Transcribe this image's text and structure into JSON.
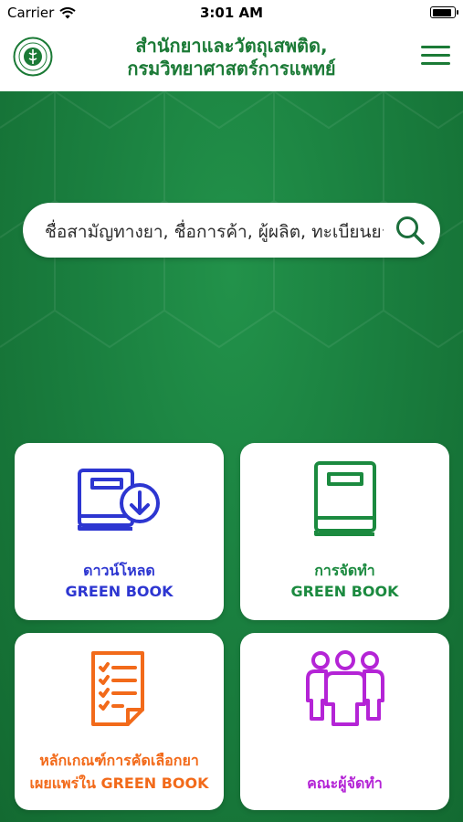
{
  "status_bar": {
    "carrier": "Carrier",
    "time": "3:01 AM",
    "battery_level": 0.9
  },
  "header": {
    "title_line1": "สำนักยาและวัตถุเสพติด,",
    "title_line2": "กรมวิทยาศาสตร์การแพทย์"
  },
  "search": {
    "placeholder": "ชื่อสามัญทางยา, ชื่อการค้า, ผู้ผลิต, ทะเบียนยา"
  },
  "tiles": [
    {
      "line1": "ดาวน์โหลด",
      "line2": "GREEN BOOK",
      "color": "#2d36d1",
      "icon": "download-book-icon"
    },
    {
      "line1": "การจัดทำ",
      "line2": "GREEN BOOK",
      "color": "#1b8a3f",
      "icon": "book-icon"
    },
    {
      "line1": "หลักเกณฑ์การคัดเลือกยา",
      "line2": "เผยแพร่ใน GREEN BOOK",
      "color": "#f26a1a",
      "icon": "checklist-document-icon"
    },
    {
      "line1": "คณะผู้จัดทำ",
      "line2": "",
      "color": "#b424d6",
      "icon": "team-people-icon"
    }
  ],
  "colors": {
    "brand_green": "#1b7a36",
    "background_green": "#1a7f3f"
  }
}
